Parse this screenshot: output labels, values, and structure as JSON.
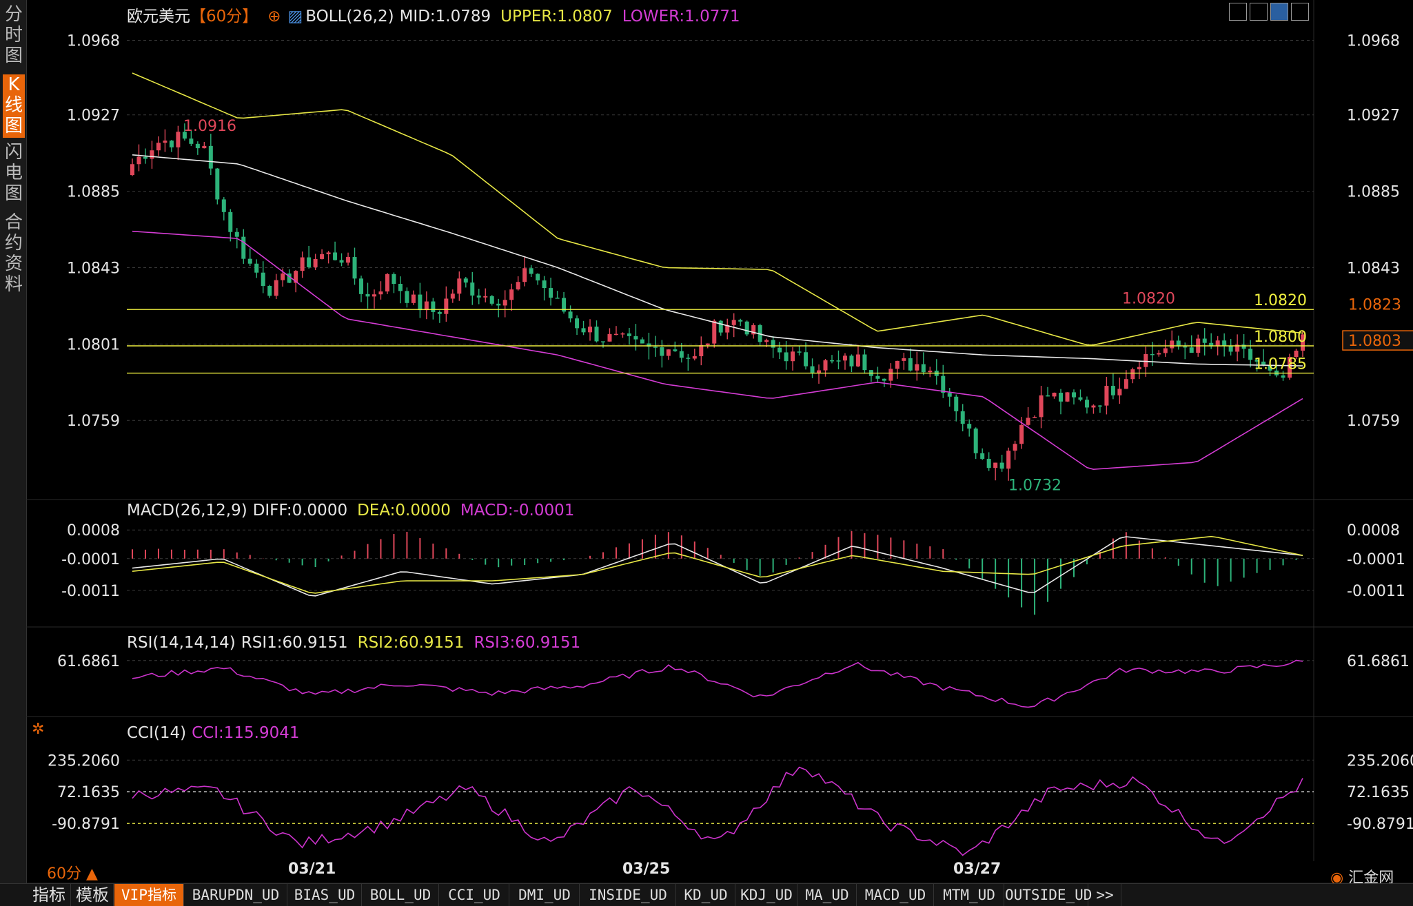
{
  "sidebar": [
    {
      "label": "分时图",
      "active": false
    },
    {
      "label": "K线图",
      "active": true
    },
    {
      "label": "闪电图",
      "active": false
    },
    {
      "label": "合约资料",
      "active": false
    }
  ],
  "header": {
    "symbol": "欧元美元",
    "period": "【60分】",
    "boll_label": "BOLL(26,2)",
    "mid": "MID:1.0789",
    "upper": "UPPER:1.0807",
    "lower": "LOWER:1.0771"
  },
  "macd_legend": {
    "name": "MACD(26,12,9)",
    "diff": "DIFF:0.0000",
    "dea": "DEA:0.0000",
    "macd": "MACD:-0.0001"
  },
  "rsi_legend": {
    "name": "RSI(14,14,14)",
    "rsi1": "RSI1:60.9151",
    "rsi2": "RSI2:60.9151",
    "rsi3": "RSI3:60.9151"
  },
  "cci_legend": {
    "name": "CCI(14)",
    "cci": "CCI:115.9041"
  },
  "period_indicator": "60分",
  "logo_text": "汇金网",
  "bottom_tabs": [
    {
      "label": "指标",
      "active": false
    },
    {
      "label": "模板",
      "active": false
    },
    {
      "label": "VIP指标",
      "active": true
    },
    {
      "label": "BARUPDN_UD",
      "active": false
    },
    {
      "label": "BIAS_UD",
      "active": false
    },
    {
      "label": "BOLL_UD",
      "active": false
    },
    {
      "label": "CCI_UD",
      "active": false
    },
    {
      "label": "DMI_UD",
      "active": false
    },
    {
      "label": "INSIDE_UD",
      "active": false
    },
    {
      "label": "KD_UD",
      "active": false
    },
    {
      "label": "KDJ_UD",
      "active": false
    },
    {
      "label": "MA_UD",
      "active": false
    },
    {
      "label": "MACD_UD",
      "active": false
    },
    {
      "label": "MTM_UD",
      "active": false
    },
    {
      "label": "OUTSIDE_UD",
      "active": false
    },
    {
      "label": ">>",
      "active": false
    }
  ],
  "colors": {
    "up": "#e0475a",
    "down": "#2db37a",
    "mid": "#e8e8e8",
    "upper": "#e6e645",
    "lower": "#d43cd4",
    "level": "#f0f040",
    "rsi": "#cc33cc",
    "cci": "#cc33cc",
    "accent": "#e8650a"
  },
  "chart_data": [
    {
      "type": "candlestick",
      "title": "欧元美元【60分】",
      "x_labels": [
        "03/21",
        "03/25",
        "03/27"
      ],
      "yticks": [
        "1.0968",
        "1.0927",
        "1.0885",
        "1.0843",
        "1.0801",
        "1.0759"
      ],
      "ylim": [
        1.0725,
        1.0975
      ],
      "annotations": [
        {
          "text": "1.0916",
          "value": 1.0916,
          "kind": "high"
        },
        {
          "text": "1.0820",
          "value": 1.0821,
          "kind": "high"
        },
        {
          "text": "1.0732",
          "value": 1.0732,
          "kind": "low"
        }
      ],
      "levels": [
        {
          "label": "1.0820",
          "value": 1.082
        },
        {
          "label": "1.0800",
          "value": 1.08
        },
        {
          "label": "1.0785",
          "value": 1.0785
        }
      ],
      "price_tags": [
        {
          "label": "1.0823",
          "value": 1.0823,
          "style": "dark"
        },
        {
          "label": "1.0803",
          "value": 1.0803,
          "style": "current"
        }
      ],
      "close_anchors": [
        1.09,
        1.0912,
        1.0914,
        1.091,
        1.087,
        1.0845,
        1.083,
        1.0842,
        1.085,
        1.0849,
        1.0826,
        1.0838,
        1.0824,
        1.0818,
        1.0835,
        1.0828,
        1.0826,
        1.0842,
        1.0825,
        1.0812,
        1.0805,
        1.0802,
        1.0798,
        1.08,
        1.0792,
        1.0812,
        1.0814,
        1.08,
        1.0795,
        1.079,
        1.079,
        1.0792,
        1.0785,
        1.079,
        1.079,
        1.0772,
        1.0745,
        1.0733,
        1.0757,
        1.0773,
        1.077,
        1.0768,
        1.0778,
        1.0793,
        1.0798,
        1.08,
        1.08,
        1.0797,
        1.0792,
        1.0778,
        1.0803
      ],
      "boll_mid": [
        1.0905,
        1.09,
        1.088,
        1.0862,
        1.0843,
        1.082,
        1.0805,
        1.0799,
        1.0795,
        1.0793,
        1.079,
        1.0789
      ],
      "boll_upper": [
        1.095,
        1.0925,
        1.093,
        1.0905,
        1.0859,
        1.0843,
        1.0842,
        1.0808,
        1.0817,
        1.08,
        1.0813,
        1.0807
      ],
      "boll_lower": [
        1.0863,
        1.0859,
        1.0815,
        1.0805,
        1.0795,
        1.0779,
        1.0771,
        1.078,
        1.0772,
        1.0732,
        1.0736,
        1.0771
      ]
    },
    {
      "type": "macd",
      "yticks": [
        "0.0008",
        "-0.0001",
        "-0.0011"
      ],
      "ylim": [
        -0.0016,
        0.001
      ],
      "diff": [
        -0.0004,
        -0.0001,
        -0.0013,
        -0.0005,
        -0.0009,
        -0.0006,
        0.0004,
        -0.0009,
        0.0003,
        -0.0004,
        -0.0012,
        0.0006,
        0.0003,
        0.0
      ],
      "dea": [
        -0.0005,
        -0.0002,
        -0.0012,
        -0.0008,
        -0.0008,
        -0.0006,
        0.0001,
        -0.0007,
        0.0,
        -0.0005,
        -0.0006,
        0.0003,
        0.0006,
        0.0
      ]
    },
    {
      "type": "line",
      "name": "RSI",
      "yticks": [
        "61.6861"
      ],
      "values": [
        53.0,
        58.0,
        44.0,
        50.0,
        45.0,
        49.0,
        59.0,
        43.0,
        60.0,
        48.0,
        38.0,
        57.0,
        56.0,
        61.0
      ]
    },
    {
      "type": "line",
      "name": "CCI",
      "yticks": [
        "235.2060",
        "72.1635",
        "-90.8791"
      ],
      "ylim": [
        -250,
        300
      ],
      "values": [
        60,
        80,
        -200,
        -100,
        90,
        -200,
        100,
        -200,
        220,
        -90,
        -250,
        80,
        130,
        -200,
        116
      ]
    }
  ]
}
